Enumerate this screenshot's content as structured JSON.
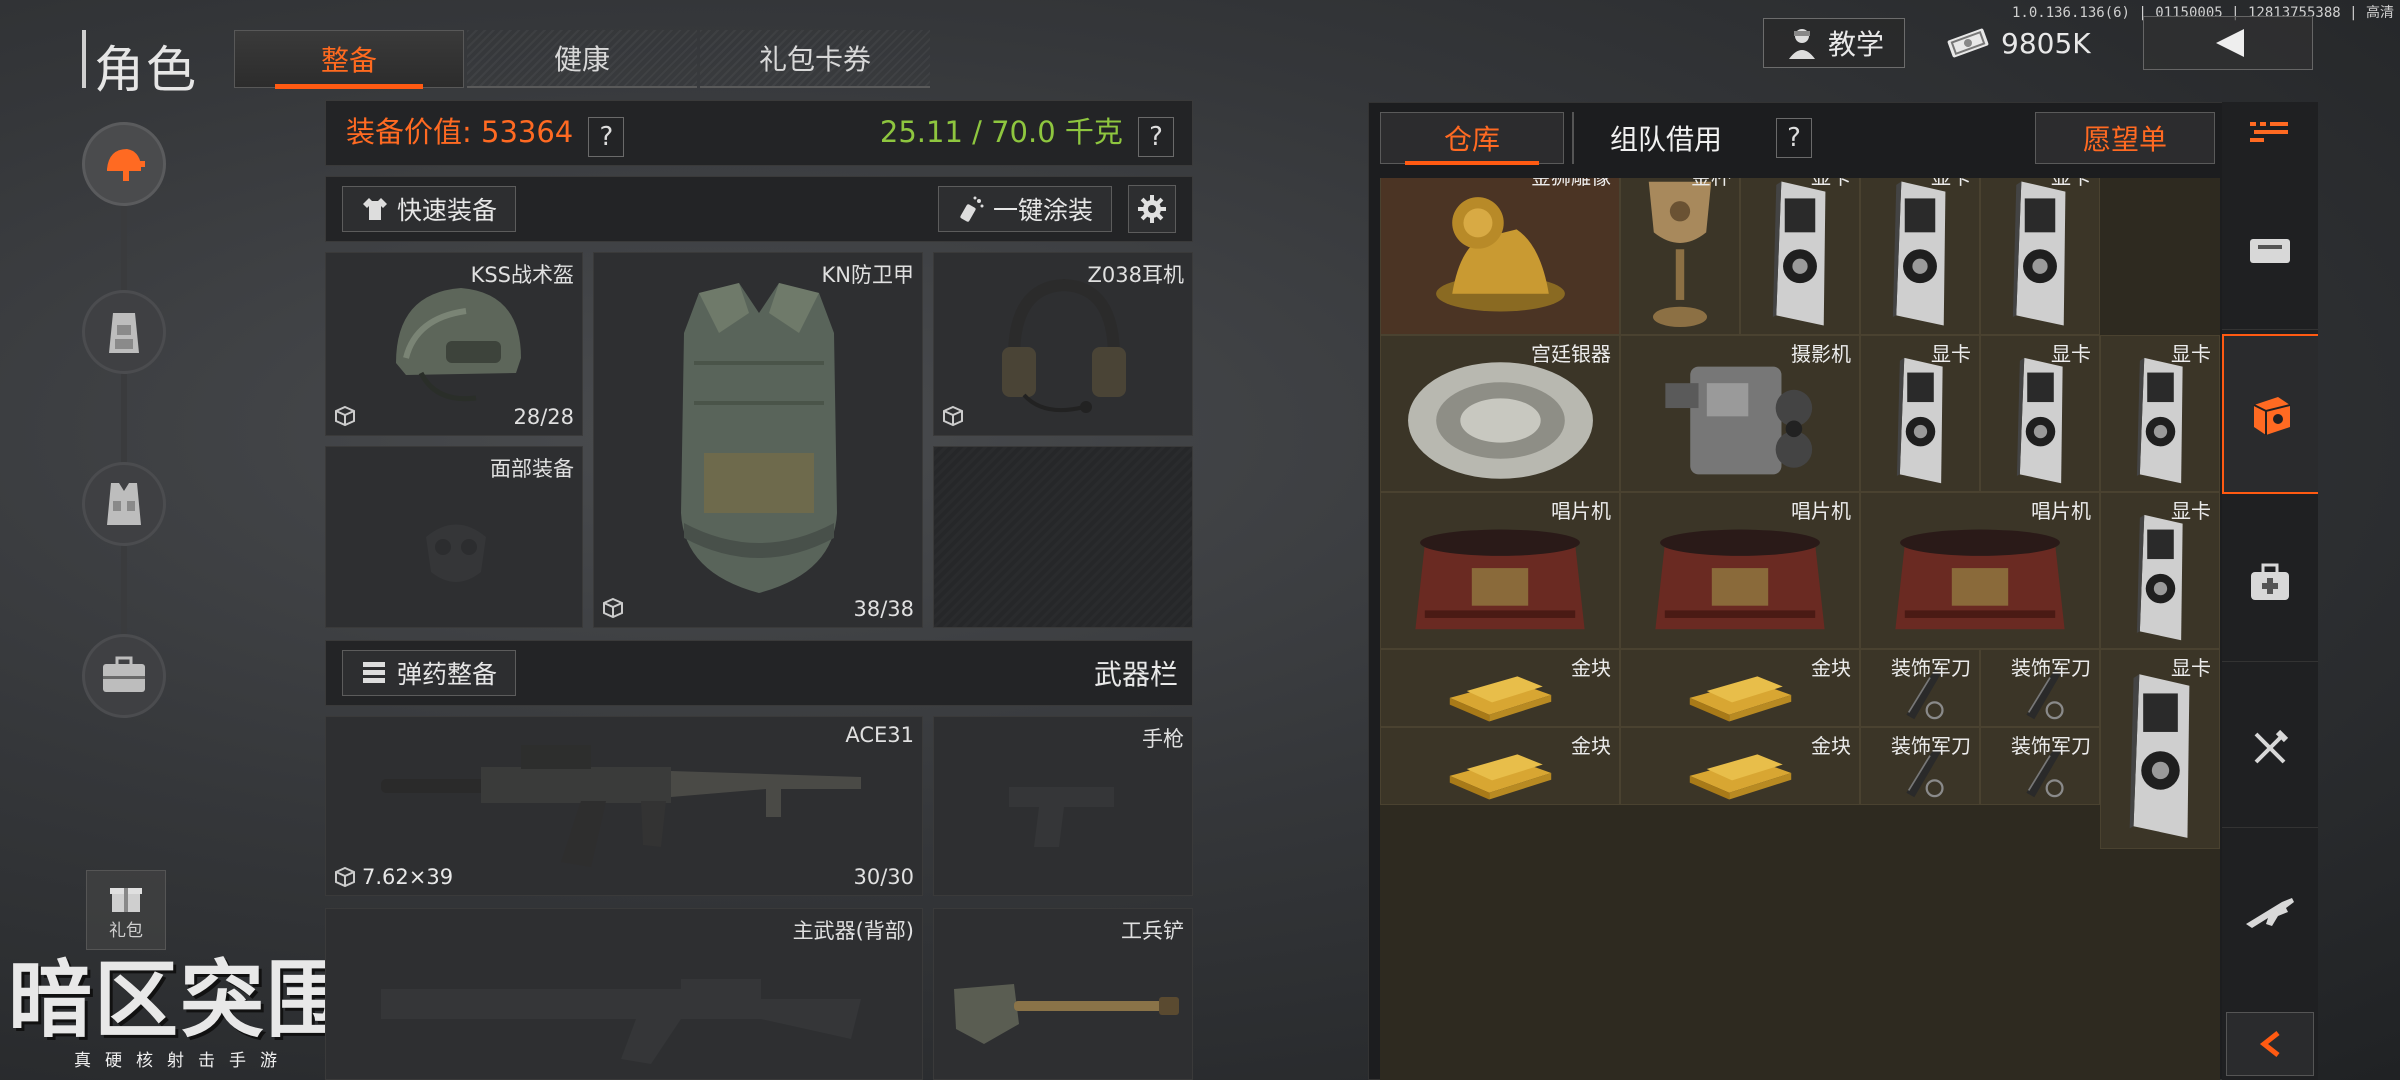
{
  "header": {
    "title": "角色",
    "tabs": [
      {
        "label": "整备",
        "active": true
      },
      {
        "label": "健康",
        "active": false
      },
      {
        "label": "礼包卡券",
        "active": false
      }
    ],
    "version": "1.0.136.136(6) | 01150005 | 12813755388 | 高清",
    "teach_label": "教学",
    "money": "9805K",
    "back_icon": "chevron-left-icon"
  },
  "sidebar": {
    "items": [
      {
        "name": "equipment",
        "icon": "helmet-gun-icon",
        "active": true
      },
      {
        "name": "backpack",
        "icon": "backpack-icon",
        "active": false
      },
      {
        "name": "rig",
        "icon": "vest-icon",
        "active": false
      },
      {
        "name": "case",
        "icon": "case-icon",
        "active": false
      }
    ],
    "gift_label": "礼包"
  },
  "logo": {
    "text": "暗区突围",
    "subtitle": "真硬核射击手游"
  },
  "equipment": {
    "value_label": "装备价值: 53364",
    "weight_label": "25.11 / 70.0 千克",
    "help": "?",
    "quick_equip": "快速装备",
    "one_click_paint": "一键涂装",
    "slots": {
      "helmet": {
        "name": "KSS战术盔",
        "durability": "28/28"
      },
      "armor": {
        "name": "KN防卫甲",
        "durability": "38/38"
      },
      "headset": {
        "name": "Z038耳机"
      },
      "face": {
        "name": "面部装备"
      }
    },
    "ammo_button": "弹药整备",
    "weapon_bar_title": "武器栏",
    "weapons": {
      "primary": {
        "name": "ACE31",
        "ammo": "7.62×39",
        "count": "30/30"
      },
      "pistol": {
        "name": "手枪"
      },
      "secondary": {
        "name": "主武器(背部)"
      },
      "melee": {
        "name": "工兵铲"
      }
    }
  },
  "warehouse": {
    "tabs": {
      "warehouse": "仓库",
      "team_borrow": "组队借用",
      "help": "?",
      "wishlist": "愿望单"
    },
    "rows": [
      [
        {
          "name": "金狮雕像",
          "kind": "lion"
        },
        {
          "name": "金杯",
          "kind": "cup"
        },
        {
          "name": "显卡",
          "kind": "gpu"
        },
        {
          "name": "显卡",
          "kind": "gpu"
        },
        {
          "name": "显卡",
          "kind": "gpu"
        }
      ],
      [
        {
          "name": "宫廷银器",
          "kind": "plate"
        },
        {
          "name": "摄影机",
          "kind": "camera"
        },
        {
          "name": "显卡",
          "kind": "gpu"
        },
        {
          "name": "显卡",
          "kind": "gpu"
        },
        {
          "name": "显卡",
          "kind": "gpu"
        }
      ],
      [
        {
          "name": "唱片机",
          "kind": "phonograph"
        },
        {
          "name": "唱片机",
          "kind": "phonograph"
        },
        {
          "name": "唱片机",
          "kind": "phonograph"
        },
        {
          "name": "显卡",
          "kind": "gpu"
        }
      ],
      [
        {
          "name": "金块",
          "kind": "gold"
        },
        {
          "name": "金块",
          "kind": "gold"
        },
        {
          "name": "装饰军刀",
          "kind": "knife"
        },
        {
          "name": "装饰军刀",
          "kind": "knife"
        },
        {
          "name": "显卡",
          "kind": "gpu"
        }
      ],
      [
        {
          "name": "金块",
          "kind": "gold"
        },
        {
          "name": "金块",
          "kind": "gold"
        },
        {
          "name": "装饰军刀",
          "kind": "knife"
        },
        {
          "name": "装饰军刀",
          "kind": "knife"
        }
      ]
    ]
  },
  "categories": [
    {
      "name": "all",
      "icon": "grid-list-icon",
      "active": false
    },
    {
      "name": "storage",
      "icon": "storage-box-icon",
      "active": false
    },
    {
      "name": "valuables",
      "icon": "treasure-box-icon",
      "active": true
    },
    {
      "name": "medical",
      "icon": "medkit-icon",
      "active": false
    },
    {
      "name": "food",
      "icon": "fork-knife-icon",
      "active": false
    },
    {
      "name": "weapons",
      "icon": "rifle-icon",
      "active": false
    }
  ],
  "colors": {
    "accent": "#ff5a12",
    "value": "#ff6a22",
    "weight": "#8ec63f"
  }
}
